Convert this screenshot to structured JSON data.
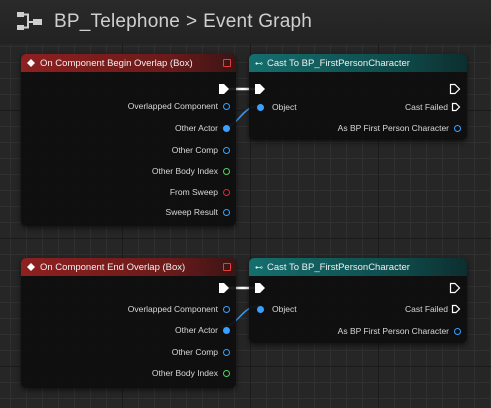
{
  "header": {
    "blueprint_name": "BP_Telephone",
    "separator": ">",
    "graph_name": "Event Graph",
    "icon": "blueprint-graph-icon"
  },
  "colors": {
    "event_header": "#8e2020",
    "cast_header": "#156e6e",
    "object_pin": "#3aa0ff",
    "int_pin": "#4cd85c",
    "bool_pin": "#d03030",
    "exec_pin": "#ffffff"
  },
  "nodes": {
    "begin_overlap": {
      "title": "On Component Begin Overlap (Box)",
      "pins": [
        "Overlapped Component",
        "Other Actor",
        "Other Comp",
        "Other Body Index",
        "From Sweep",
        "Sweep Result"
      ]
    },
    "cast_1": {
      "title": "Cast To BP_FirstPersonCharacter",
      "object_label": "Object",
      "cast_failed": "Cast Failed",
      "as_output": "As BP First Person Character"
    },
    "end_overlap": {
      "title": "On Component End Overlap (Box)",
      "pins": [
        "Overlapped Component",
        "Other Actor",
        "Other Comp",
        "Other Body Index"
      ]
    },
    "cast_2": {
      "title": "Cast To BP_FirstPersonCharacter",
      "object_label": "Object",
      "cast_failed": "Cast Failed",
      "as_output": "As BP First Person Character"
    }
  }
}
